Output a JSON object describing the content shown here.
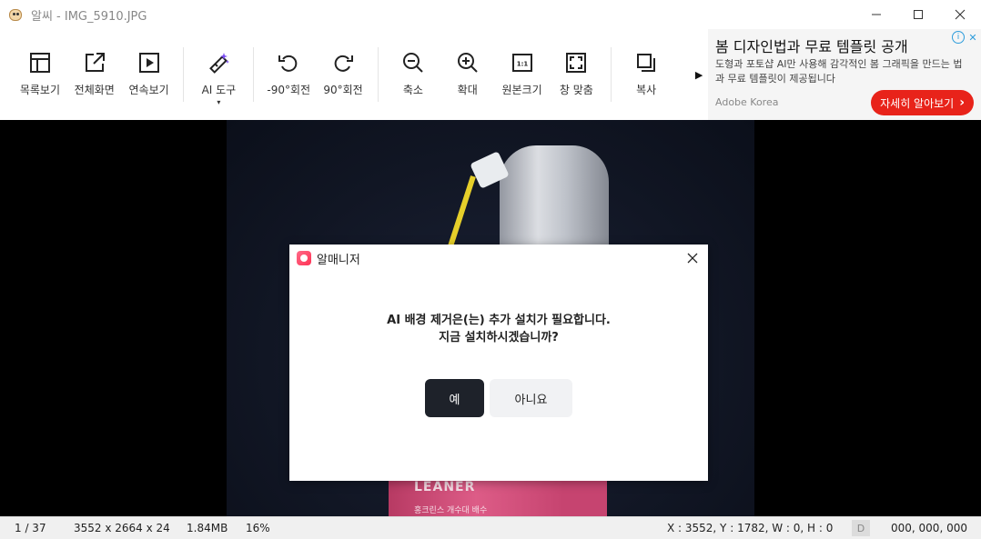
{
  "window": {
    "title": "알씨 - IMG_5910.JPG",
    "controls": {
      "minimize": "—",
      "maximize": "☐",
      "close": "✕"
    }
  },
  "toolbar": {
    "items": [
      {
        "label": "목록보기",
        "icon": "list-view-icon"
      },
      {
        "label": "전체화면",
        "icon": "fullscreen-icon"
      },
      {
        "label": "연속보기",
        "icon": "slideshow-icon"
      },
      {
        "label": "AI 도구",
        "icon": "ai-magic-wand-icon",
        "caret": "▾"
      },
      {
        "label": "-90°회전",
        "icon": "rotate-left-icon"
      },
      {
        "label": "90°회전",
        "icon": "rotate-right-icon"
      },
      {
        "label": "축소",
        "icon": "zoom-out-icon"
      },
      {
        "label": "확대",
        "icon": "zoom-in-icon"
      },
      {
        "label": "원본크기",
        "icon": "original-size-icon",
        "icon_text": "1:1"
      },
      {
        "label": "창 맞춤",
        "icon": "fit-window-icon"
      },
      {
        "label": "복사",
        "icon": "copy-icon"
      }
    ],
    "more": "▶"
  },
  "ad": {
    "title": "봄 디자인법과 무료 템플릿 공개",
    "body": "도형과 포토샵 AI만 사용해 감각적인 봄 그래픽을 만드는 법과 무료 템플릿이 제공됩니다",
    "source": "Adobe Korea",
    "cta": "자세히 알아보기",
    "cta_arrow": "›",
    "info": "i",
    "close": "✕"
  },
  "photo": {
    "can_text1": "LEANER",
    "can_text2": "홍크린스 개수대 배수"
  },
  "dialog": {
    "title": "알매니저",
    "close": "✕",
    "message_line1": "AI 배경 제거은(는) 추가 설치가 필요합니다.",
    "message_line2": "지금 설치하시겠습니까?",
    "yes": "예",
    "no": "아니요"
  },
  "status": {
    "index": "1 / 37",
    "dimensions": "3552 x 2664 x 24",
    "filesize": "1.84MB",
    "zoom": "16%",
    "coords": "X : 3552, Y : 1782, W : 0, H : 0",
    "d_badge": "D",
    "color": "000, 000, 000"
  },
  "colors": {
    "accent_red": "#e8231a",
    "dialog_yes_bg": "#1e222a",
    "viewer_bg": "#000000"
  }
}
